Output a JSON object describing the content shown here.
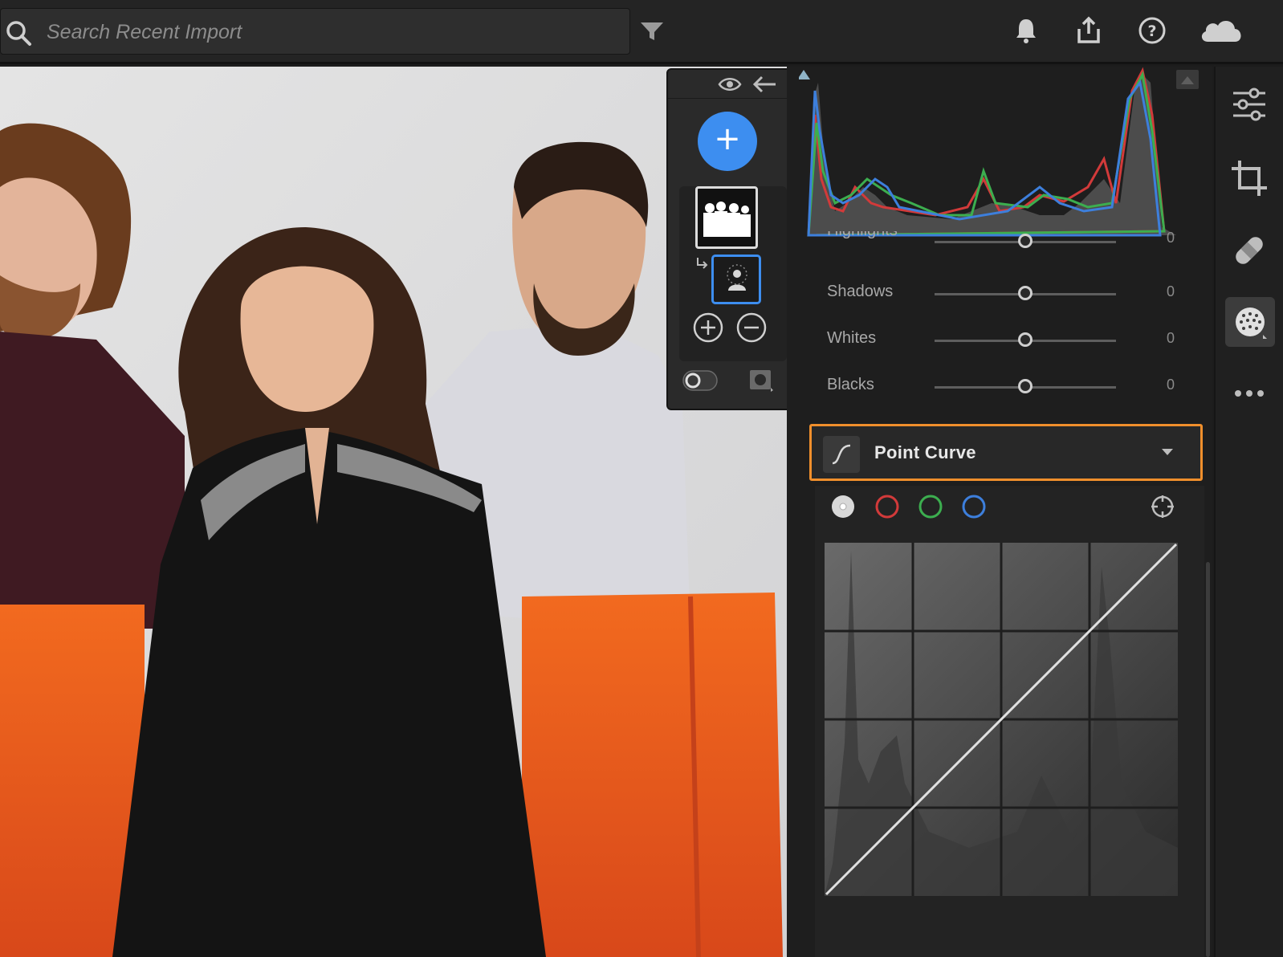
{
  "search": {
    "placeholder": "Search Recent Import",
    "icon": "search-icon"
  },
  "header_icons": [
    "filter-icon",
    "bell-icon",
    "share-icon",
    "help-icon",
    "cloud-icon"
  ],
  "masking": {
    "add_label": "+",
    "mask_thumbnail": "people-mask-thumbnail",
    "submask": "select-people-icon",
    "header_icons": [
      "eye-icon",
      "back-arrow-icon"
    ],
    "footer_icons": [
      "toggle-icon",
      "overlay-icon"
    ]
  },
  "light": {
    "partial_label": "Highlights",
    "partial_value": "0",
    "rows": [
      {
        "label": "Shadows",
        "value": "0"
      },
      {
        "label": "Whites",
        "value": "0"
      },
      {
        "label": "Blacks",
        "value": "0"
      }
    ]
  },
  "point_curve": {
    "title": "Point Curve",
    "channels": [
      "white",
      "red",
      "green",
      "blue"
    ],
    "colors": {
      "white": "#d8d8d8",
      "red": "#d23a3a",
      "green": "#3cae4f",
      "blue": "#3d7fdc",
      "accent": "#f08f2c"
    }
  },
  "rail_icons": [
    "edit-sliders-icon",
    "crop-icon",
    "healing-icon",
    "masking-icon",
    "more-icon"
  ],
  "histogram": {
    "series": [
      "red",
      "green",
      "blue"
    ]
  }
}
